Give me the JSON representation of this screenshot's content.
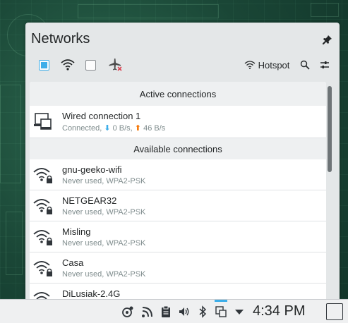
{
  "popup": {
    "title": "Networks",
    "toolbar": {
      "wifi_enabled": true,
      "mobile_enabled": false,
      "hotspot_label": "Hotspot"
    }
  },
  "sections": {
    "active": "Active connections",
    "available": "Available connections"
  },
  "active_connections": [
    {
      "name": "Wired connection 1",
      "status": "Connected,",
      "down_arrow": "⬇",
      "down_rate": "0 B/s,",
      "up_arrow": "⬆",
      "up_rate": "46 B/s"
    }
  ],
  "available_connections": [
    {
      "name": "gnu-geeko-wifi",
      "status": "Never used, WPA2-PSK"
    },
    {
      "name": "NETGEAR32",
      "status": "Never used, WPA2-PSK"
    },
    {
      "name": "Misling",
      "status": "Never used, WPA2-PSK"
    },
    {
      "name": "Casa",
      "status": "Never used, WPA2-PSK"
    },
    {
      "name": "DiLusiak-2.4G",
      "status": ""
    }
  ],
  "taskbar": {
    "clock": "4:34 PM"
  },
  "colors": {
    "accent": "#3daee9",
    "upload": "#f67400",
    "popup_bg": "#e4e7e8"
  }
}
